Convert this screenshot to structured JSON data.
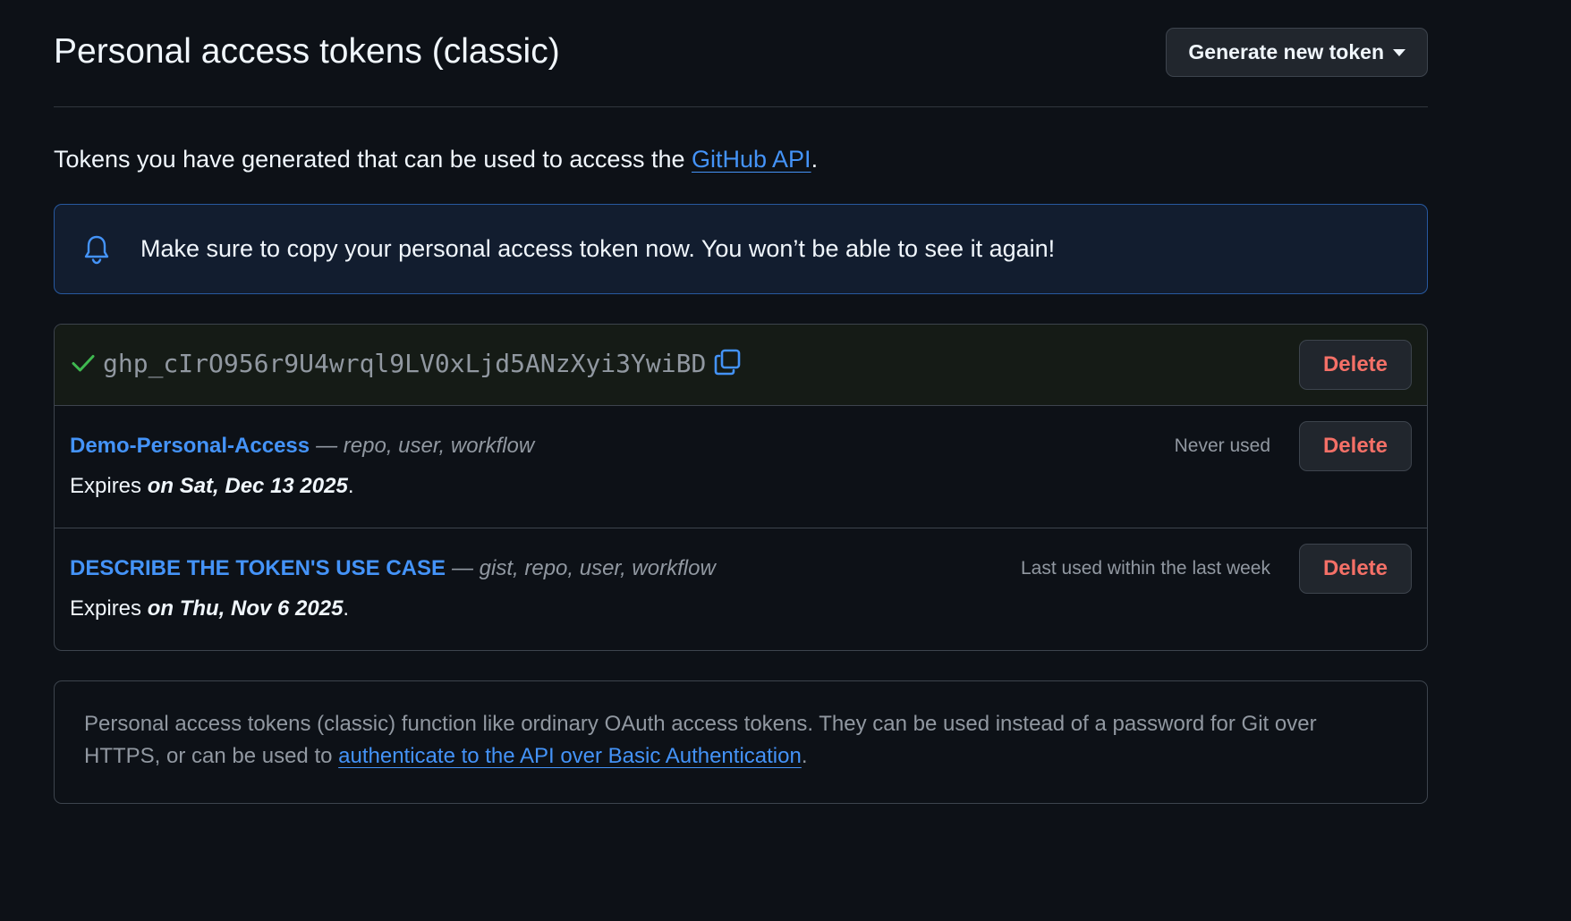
{
  "header": {
    "title": "Personal access tokens (classic)",
    "generate_button_label": "Generate new token"
  },
  "intro": {
    "text_before": "Tokens you have generated that can be used to access the ",
    "link_text": "GitHub API",
    "text_after": "."
  },
  "flash": {
    "icon": "bell-icon",
    "message": "Make sure to copy your personal access token now. You won’t be able to see it again!"
  },
  "new_token": {
    "status_icon": "check-icon",
    "value": "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",
    "copy_icon": "copy-icon",
    "delete_label": "Delete"
  },
  "tokens": [
    {
      "name": "Demo-Personal-Access",
      "scopes": "— repo, user, workflow",
      "last_used": "Never used",
      "expires_prefix": "Expires ",
      "expires_date": "on Sat, Dec 13 2025",
      "expires_suffix": ".",
      "delete_label": "Delete"
    },
    {
      "name": "DESCRIBE THE TOKEN'S USE CASE",
      "scopes": "— gist, repo, user, workflow",
      "last_used": "Last used within the last week",
      "expires_prefix": "Expires ",
      "expires_date": "on Thu, Nov 6 2025",
      "expires_suffix": ".",
      "delete_label": "Delete"
    }
  ],
  "info": {
    "text_before": "Personal access tokens (classic) function like ordinary OAuth access tokens. They can be used instead of a password for Git over HTTPS, or can be used to ",
    "link_text": "authenticate to the API over Basic Authentication",
    "text_after": "."
  },
  "colors": {
    "background": "#0d1117",
    "link": "#4493f8",
    "danger": "#f47067",
    "success": "#3fb950",
    "flash_border": "#1f6feb"
  }
}
